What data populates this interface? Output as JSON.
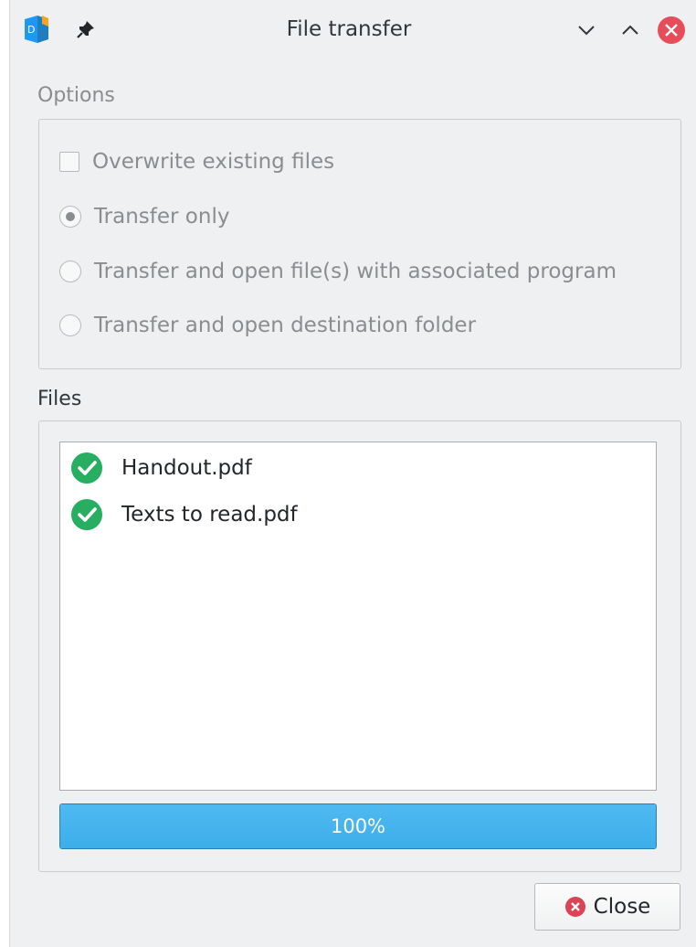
{
  "window": {
    "title": "File transfer",
    "icons": {
      "app": "document-app-icon",
      "pin": "pin-icon",
      "minimize": "chevron-down-icon",
      "maximize": "chevron-up-icon",
      "close": "close-circle-icon"
    }
  },
  "options": {
    "label": "Options",
    "overwrite_checkbox": {
      "label": "Overwrite existing files",
      "checked": false,
      "enabled": false
    },
    "radios": [
      {
        "label": "Transfer only",
        "selected": true
      },
      {
        "label": "Transfer and open file(s) with associated program",
        "selected": false
      },
      {
        "label": "Transfer and open destination folder",
        "selected": false
      }
    ]
  },
  "files": {
    "label": "Files",
    "items": [
      {
        "name": "Handout.pdf",
        "status_icon": "check-circle-icon"
      },
      {
        "name": "Texts to read.pdf",
        "status_icon": "check-circle-icon"
      }
    ]
  },
  "progress": {
    "value": 100,
    "text": "100%"
  },
  "footer": {
    "close_label": "Close",
    "close_icon": "close-circle-icon"
  },
  "colors": {
    "accent": "#3daee9",
    "success": "#27ae60",
    "danger": "#da4453"
  }
}
